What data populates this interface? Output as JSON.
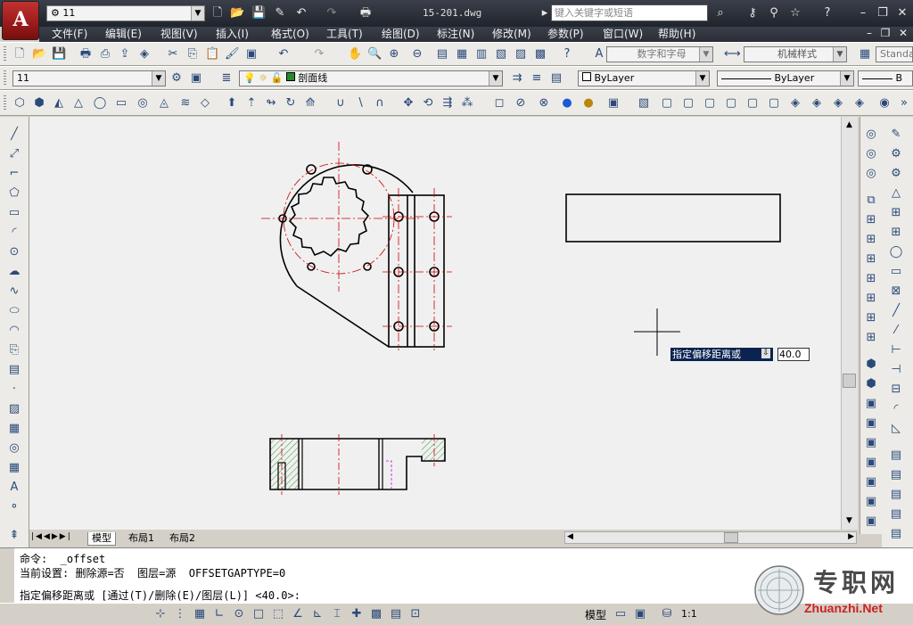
{
  "title_bar": {
    "app_logo": "A",
    "workspace_combo": "11",
    "file_title": "15-201.dwg",
    "search_placeholder": "键入关键字或短语"
  },
  "menu": [
    "文件(F)",
    "编辑(E)",
    "视图(V)",
    "插入(I)",
    "格式(O)",
    "工具(T)",
    "绘图(D)",
    "标注(N)",
    "修改(M)",
    "参数(P)",
    "窗口(W)",
    "帮助(H)"
  ],
  "styles_toolbar": {
    "text_style": "数字和字母",
    "dim_style": "机械样式",
    "table_style": "Standa"
  },
  "layers_toolbar": {
    "workspace": "11",
    "current_layer": "剖面线",
    "color": "ByLayer",
    "linetype": "ByLayer",
    "lineweight": "B"
  },
  "tabs": [
    "模型",
    "布局1",
    "布局2"
  ],
  "command": {
    "line1": "命令:  _offset",
    "line2": "当前设置: 删除源=否  图层=源  OFFSETGAPTYPE=0",
    "line3": "指定偏移距离或 [通过(T)/删除(E)/图层(L)] <40.0>:"
  },
  "dynamic_input": {
    "prompt": "指定偏移距离或",
    "value": "40.0"
  },
  "status_bar": {
    "model_label": "模型",
    "scale": "1:1"
  },
  "watermark": {
    "text": "专职网",
    "url": "Zhuanzhi.Net"
  },
  "colors": {
    "accent": "#2b4a7a",
    "centerline": "#cc0000",
    "hatch": "#3a9a3a",
    "canvas_bg": "#f0f0f0"
  }
}
